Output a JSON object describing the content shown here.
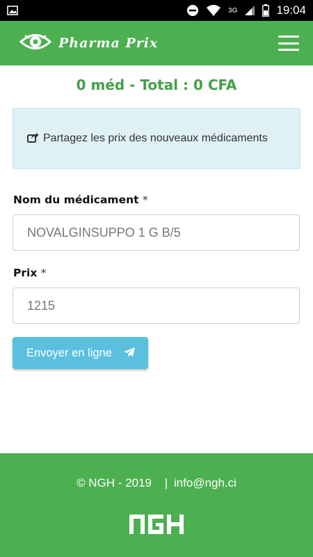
{
  "status_bar": {
    "time": "19:04",
    "network_label": "3G",
    "icons": [
      "image-icon",
      "do-not-disturb-icon",
      "wifi-icon",
      "3g-icon",
      "signal-icon",
      "battery-icon"
    ]
  },
  "header": {
    "brand_name": "Pharma Prix",
    "logo_icon": "eye-logo-icon",
    "menu_icon": "hamburger-menu-icon"
  },
  "summary": {
    "text": "0 méd - Total : 0 CFA"
  },
  "info": {
    "icon": "share-icon",
    "text": "Partagez les prix des nouveaux médicaments"
  },
  "form": {
    "name_label": "Nom du médicament",
    "name_required": "*",
    "name_placeholder": "NOVALGINSUPPO 1 G B/5",
    "price_label": "Prix",
    "price_required": "*",
    "price_placeholder": "1215",
    "submit_label": "Envoyer en ligne",
    "submit_icon": "paper-plane-icon"
  },
  "footer": {
    "copyright": "© NGH - 2019",
    "separator": "|",
    "email": "info@ngh.ci",
    "logo_text": "NGH"
  },
  "colors": {
    "primary_green": "#4caf50",
    "summary_green": "#43a047",
    "info_bg": "#dff0f7",
    "button_blue": "#5bc0de"
  }
}
